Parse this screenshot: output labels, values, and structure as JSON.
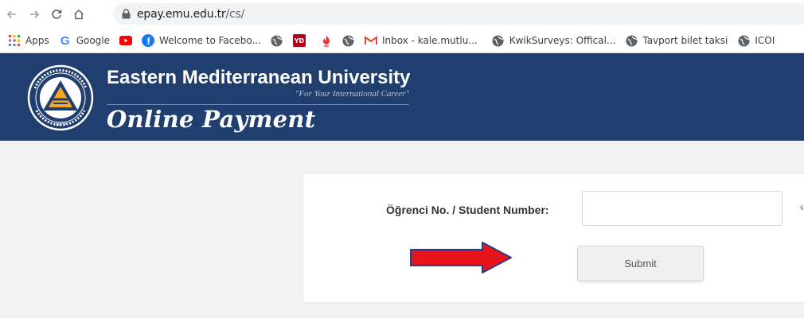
{
  "browser": {
    "url_host": "epay.emu.edu.tr",
    "url_path": "/cs/",
    "bookmarks": [
      {
        "label": "Apps",
        "icon": "apps-grid-icon"
      },
      {
        "label": "Google",
        "icon": "google-icon"
      },
      {
        "label": "",
        "icon": "youtube-icon"
      },
      {
        "label": "Welcome to Facebo...",
        "icon": "facebook-icon"
      },
      {
        "label": "",
        "icon": "globe-icon"
      },
      {
        "label": "YD",
        "icon": "yd-icon"
      },
      {
        "label": "",
        "icon": "flame-icon"
      },
      {
        "label": "",
        "icon": "globe-icon"
      },
      {
        "label": "Inbox - kale.mutlu...",
        "icon": "gmail-icon"
      },
      {
        "label": "KwikSurveys: Offical...",
        "icon": "globe-icon"
      },
      {
        "label": "Tavport bilet taksi",
        "icon": "globe-icon"
      },
      {
        "label": "ICOI",
        "icon": "globe-icon"
      }
    ]
  },
  "banner": {
    "university_name": "Eastern Mediterranean University",
    "tagline": "\"For Your International Career\"",
    "subtitle": "Online Payment",
    "logo_year": "1979",
    "colors": {
      "background": "#203f6e",
      "logo_accent": "#f5a623"
    }
  },
  "form": {
    "student_label": "Öğrenci No. / Student Number:",
    "student_value": "",
    "student_placeholder": "",
    "submit_label": "Submit",
    "trailing_glyph": "‹"
  },
  "annotation": {
    "arrow_color": "#e8141b",
    "arrow_outline": "#2a3a8c"
  }
}
